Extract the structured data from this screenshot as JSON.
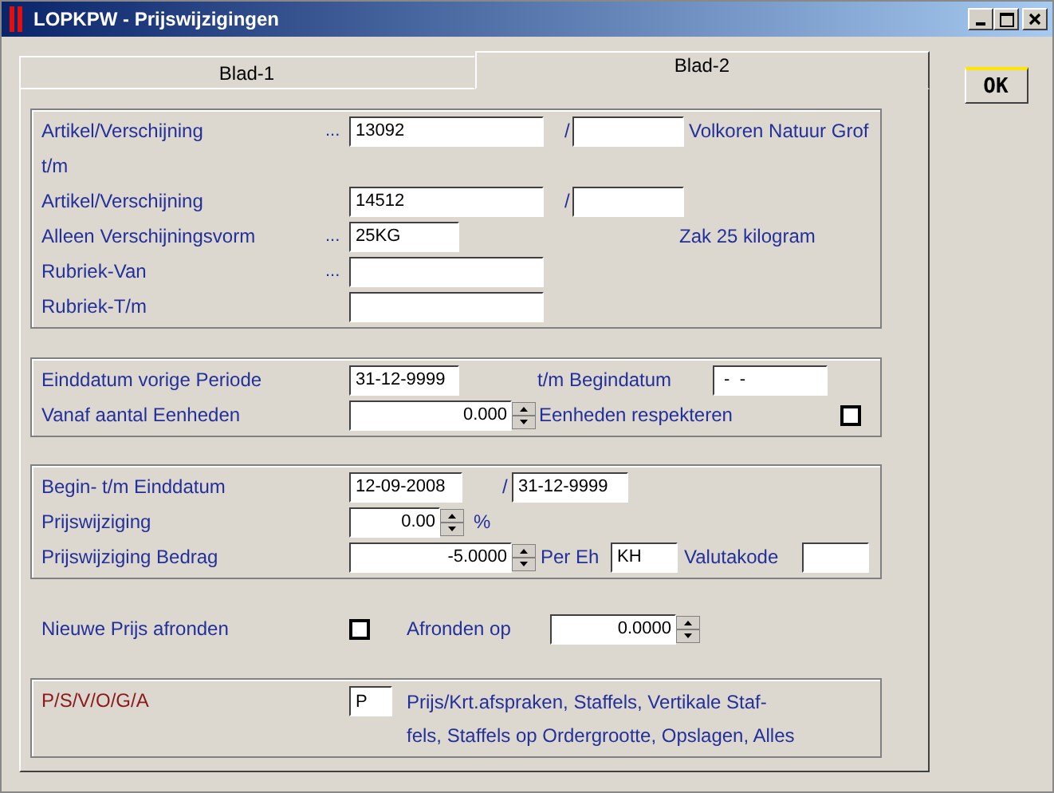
{
  "window": {
    "title": "LOPKPW - Prijswijzigingen"
  },
  "tabs": [
    {
      "label": "Blad-1",
      "selected": false
    },
    {
      "label": "Blad-2",
      "selected": true
    }
  ],
  "ok_button": "OK",
  "selection": {
    "from_label": "Artikel/Verschijning",
    "from_lookup": "...",
    "from_article": "13092",
    "from_slash": "/",
    "from_description": "Volkoren Natuur Grof",
    "tm_label": "t/m",
    "to_label": "Artikel/Verschijning",
    "to_article": "14512",
    "to_slash": "/",
    "form_label": "Alleen Verschijningsvorm",
    "form_lookup": "...",
    "form_value": "25KG",
    "form_description": "Zak 25 kilogram",
    "rubric_from_label": "Rubriek-Van",
    "rubric_from_lookup": "...",
    "rubric_to_label": "Rubriek-T/m"
  },
  "period": {
    "end_label": "Einddatum vorige Periode",
    "end_value": "31-12-9999",
    "begin_label": "t/m Begindatum",
    "begin_value": " -  -",
    "units_label": "Vanaf aantal Eenheden",
    "units_value": "0.000",
    "respect_label": "Eenheden respekteren",
    "respect_checked": false
  },
  "validity": {
    "dates_label": "Begin- t/m Einddatum",
    "start_value": "12-09-2008",
    "slash": "/",
    "end_value": "31-12-9999",
    "pct_label": "Prijswijziging",
    "pct_value": "0.00",
    "pct_unit": "%",
    "amount_label": "Prijswijziging Bedrag",
    "amount_value": "-5.0000",
    "per_unit_label": "Per Eh",
    "per_unit_value": "KH",
    "currency_label": "Valutakode"
  },
  "rounding": {
    "label": "Nieuwe Prijs afronden",
    "checked": false,
    "round_label": "Afronden op",
    "round_value": "0.0000"
  },
  "price_type": {
    "label": "P/S/V/O/G/A",
    "value": "P",
    "description_lines": [
      "Prijs/Krt.afspraken, Staffels, Vertikale Staf-",
      "fels, Staffels op Ordergrootte, Opslagen, Alles"
    ]
  }
}
